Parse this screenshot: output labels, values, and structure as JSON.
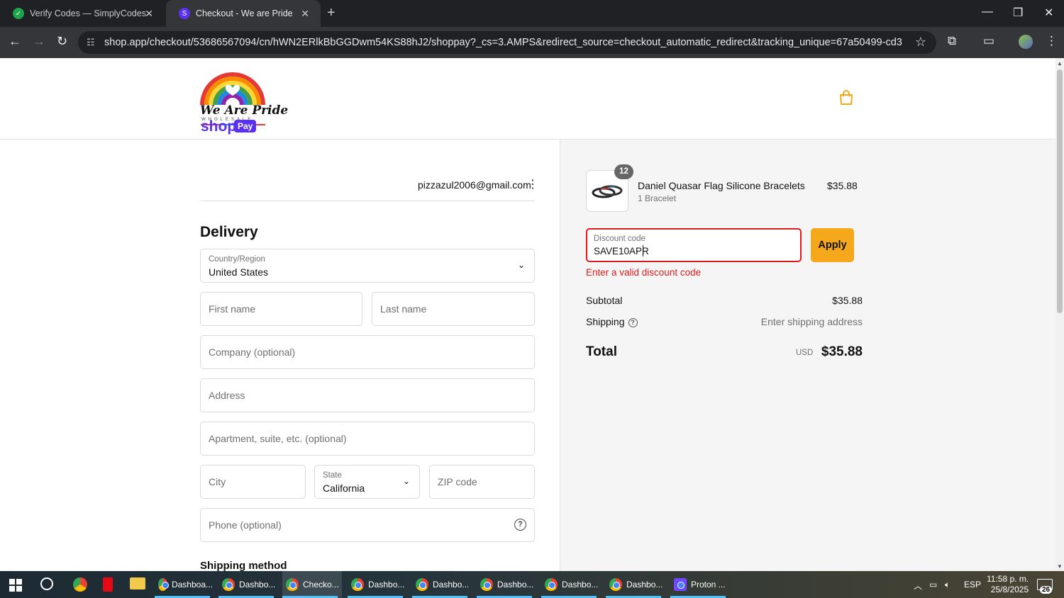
{
  "browser": {
    "tabs": [
      {
        "title": "Verify Codes — SimplyCodes",
        "active": false
      },
      {
        "title": "Checkout - We are Pride",
        "active": true
      }
    ],
    "url": "shop.app/checkout/53686567094/cn/hWN2ERlkBbGGDwm54KS88hJ2/shoppay?_cs=3.AMPS&redirect_source=checkout_automatic_redirect&tracking_unique=67a50499-cd33-4c23-8368-f2f7b6..."
  },
  "store": {
    "logo_text": "We Are Pride",
    "logo_sub": "WHOLESALE"
  },
  "shop_pay": {
    "brand": "shop",
    "badge": "Pay",
    "email": "pizzazul2006@gmail.com"
  },
  "delivery": {
    "heading": "Delivery",
    "country_label": "Country/Region",
    "country_value": "United States",
    "first_name_ph": "First name",
    "last_name_ph": "Last name",
    "company_ph": "Company (optional)",
    "address_ph": "Address",
    "apartment_ph": "Apartment, suite, etc. (optional)",
    "city_ph": "City",
    "state_label": "State",
    "state_value": "California",
    "zip_ph": "ZIP code",
    "phone_ph": "Phone (optional)",
    "shipping_method_heading": "Shipping method"
  },
  "order": {
    "quantity": "12",
    "product_name": "Daniel Quasar Flag Silicone Bracelets",
    "product_variant": "1 Bracelet",
    "product_price": "$35.88",
    "discount_label": "Discount code",
    "discount_value": "SAVE10APR",
    "apply_label": "Apply",
    "discount_error": "Enter a valid discount code",
    "subtotal_label": "Subtotal",
    "subtotal_value": "$35.88",
    "shipping_label": "Shipping",
    "shipping_value": "Enter shipping address",
    "total_label": "Total",
    "total_currency": "USD",
    "total_value": "$35.88"
  },
  "taskbar": {
    "apps": [
      {
        "label": "Dashboa..."
      },
      {
        "label": "Dashbo..."
      },
      {
        "label": "Checko..."
      },
      {
        "label": "Dashbo..."
      },
      {
        "label": "Dashbo..."
      },
      {
        "label": "Dashbo..."
      },
      {
        "label": "Dashbo..."
      },
      {
        "label": "Dashbo..."
      },
      {
        "label": "Proton ..."
      }
    ],
    "language": "ESP",
    "time": "11:58 p. m.",
    "date": "25/8/2025",
    "notifications": "26"
  },
  "colors": {
    "shop_purple": "#5a31f4",
    "apply_orange": "#f5a81c",
    "error_red": "#dd1d1d"
  }
}
